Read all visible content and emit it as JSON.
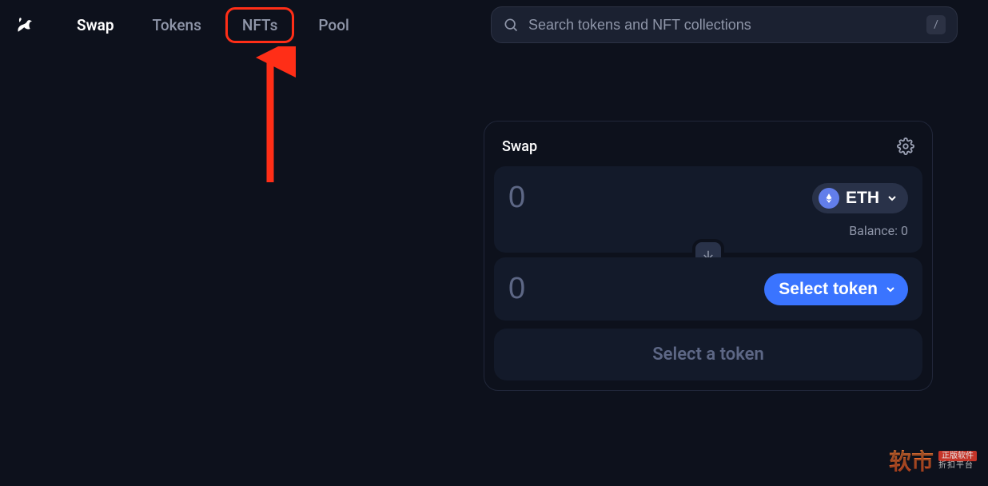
{
  "nav": {
    "items": [
      {
        "label": "Swap",
        "active": true
      },
      {
        "label": "Tokens",
        "active": false
      },
      {
        "label": "NFTs",
        "active": false,
        "highlighted": true
      },
      {
        "label": "Pool",
        "active": false
      }
    ]
  },
  "search": {
    "placeholder": "Search tokens and NFT collections",
    "shortcut": "/"
  },
  "swap": {
    "title": "Swap",
    "from": {
      "amount": "0",
      "token_symbol": "ETH",
      "balance_label": "Balance: 0"
    },
    "to": {
      "amount": "0",
      "select_label": "Select token"
    },
    "cta_label": "Select a token"
  },
  "watermark": {
    "main": "软市",
    "tag1": "正版软件",
    "tag2": "折扣平台"
  }
}
